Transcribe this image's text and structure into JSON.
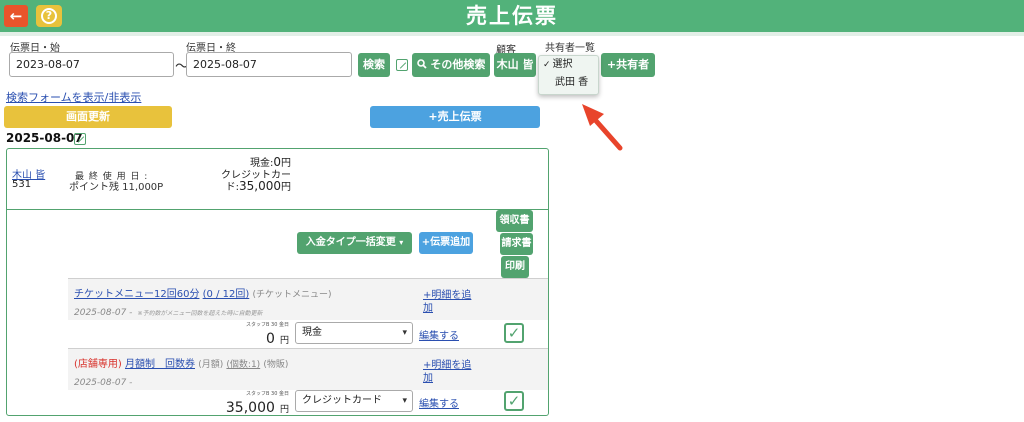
{
  "header": {
    "title": "売上伝票",
    "back_icon": "arrow-left-icon",
    "help_icon": "question-icon",
    "back_glyph": "←",
    "help_glyph": "?"
  },
  "search": {
    "date_start_label": "伝票日・始",
    "date_start_value": "2023-08-07",
    "tilde": "〜",
    "date_end_label": "伝票日・終",
    "date_end_value": "2025-08-07",
    "search_button": "検索",
    "other_search_button": "その他検索",
    "customer_label": "顧客",
    "customer_button": "木山 皆",
    "sharer_label": "共有者一覧",
    "add_sharer_button": "+共有者",
    "toggle_link": "検索フォームを表示/非表示"
  },
  "dropdown": {
    "options": [
      "選択",
      "武田 香"
    ],
    "selected": "選択"
  },
  "actions": {
    "refresh_button": "画面更新",
    "new_slip_button": "+売上伝票"
  },
  "slip": {
    "date": "2025-08-07",
    "customer_name": "木山 皆",
    "customer_id": "531",
    "last_used_label": "最 終 使 用 日 :",
    "points": "ポイント残 11,000P",
    "cash_label": "現金:",
    "cash_value": "0",
    "cash_unit": "円",
    "credit_label_1": "クレジットカー",
    "credit_label_2": "ド:",
    "credit_value": "35,000",
    "credit_unit": "円",
    "payment_type_button": "入金タイプ一括変更",
    "add_slip_button": "+伝票追加",
    "receipt_button": "領収書",
    "invoice_button": "請求書",
    "print_button": "印刷"
  },
  "items": [
    {
      "title": "チケットメニュー12回60分",
      "count": "(0 / 12回)",
      "category": "(チケットメニュー)",
      "date": "2025-08-07 -",
      "note": "※予約数がメニュー回数を超えた時に自動更新",
      "add_detail_1": "+明細を追",
      "add_detail_2": "加",
      "staff_label": "スタッフB 30 金日",
      "amount": "0",
      "unit": "円",
      "payment": "現金",
      "edit_link": "編集する",
      "checked": true
    },
    {
      "tag": "(店舗専用)",
      "title": "月額制　回数券",
      "category": "(月額)",
      "qty": "(個数:1)",
      "type": "(物販)",
      "date": "2025-08-07 -",
      "add_detail_1": "+明細を追",
      "add_detail_2": "加",
      "staff_label": "スタッフB 30 金日",
      "amount": "35,000",
      "unit": "円",
      "payment": "クレジットカード",
      "edit_link": "編集する",
      "checked": true
    }
  ],
  "colors": {
    "header_green": "#52b27a",
    "button_green": "#52a36f",
    "accent_yellow": "#e8c23c",
    "accent_blue": "#4ca2e0",
    "back_red": "#e8542b",
    "arrow_red": "#e8442b"
  }
}
